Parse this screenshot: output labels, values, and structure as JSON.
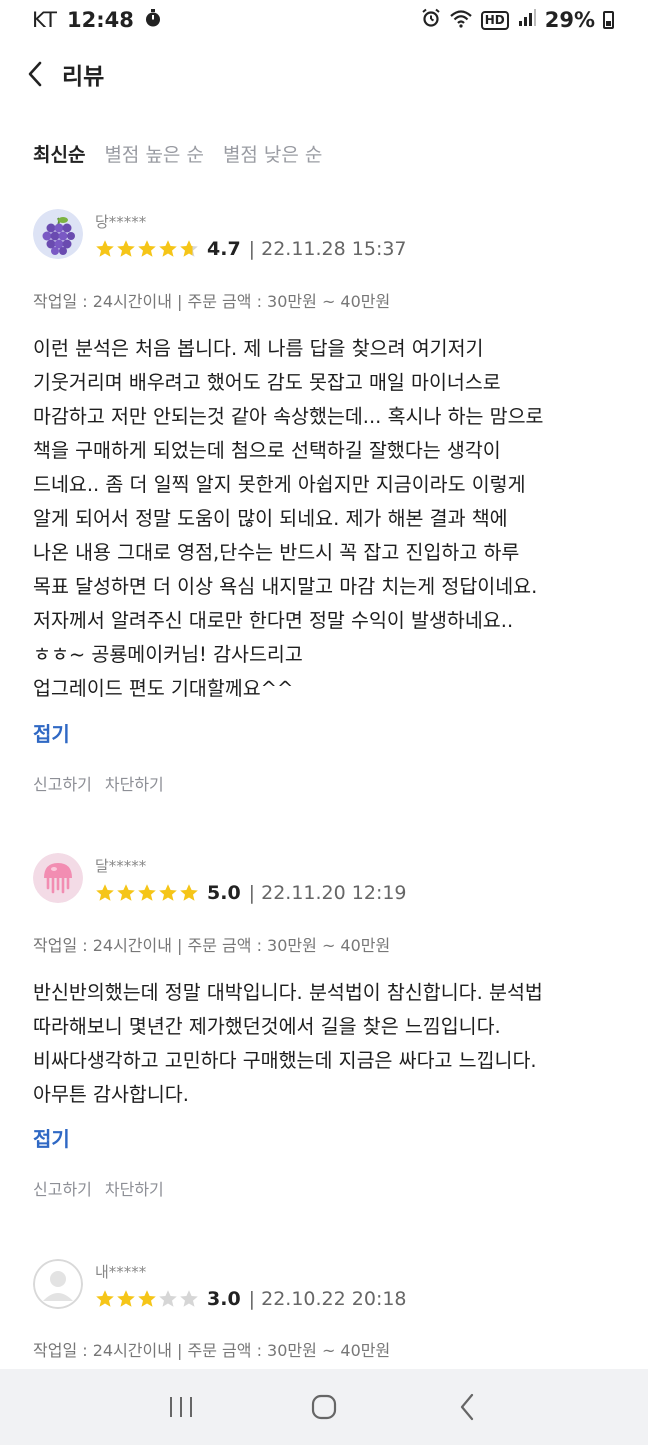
{
  "status_bar": {
    "carrier": "KT",
    "time": "12:48",
    "battery": "29%",
    "hd": "HD"
  },
  "header": {
    "title": "리뷰"
  },
  "sort_tabs": [
    "최신순",
    "별점 높은 순",
    "별점 낮은 순"
  ],
  "reviews": [
    {
      "name": "당*****",
      "avatar": "grape",
      "rating": 4.7,
      "rating_text": "4.7",
      "date": "| 22.11.28 15:37",
      "meta": "작업일 : 24시간이내 | 주문 금액 : 30만원 ~ 40만원",
      "body": "이런 분석은 처음 봅니다. 제 나름 답을 찾으려 여기저기\n기웃거리며 배우려고 했어도 감도 못잡고 매일 마이너스로\n마감하고 저만 안되는것 같아 속상했는데... 혹시나 하는 맘으로\n책을 구매하게 되었는데 첨으로 선택하길 잘했다는 생각이\n드네요.. 좀 더 일찍 알지 못한게 아쉽지만 지금이라도 이렇게\n알게 되어서 정말 도움이 많이 되네요.  제가  해본 결과 책에\n나온 내용 그대로 영점,단수는 반드시 꼭 잡고 진입하고 하루\n목표 달성하면 더 이상 욕심 내지말고 마감 치는게 정답이네요.\n저자께서 알려주신 대로만 한다면 정말 수익이 발생하네요..\nㅎㅎ~                                         공룡메이커님!  감사드리고\n업그레이드 편도 기대할께요^^",
      "collapse": "접기",
      "report": "신고하기",
      "block": "차단하기"
    },
    {
      "name": "달*****",
      "avatar": "jellyfish",
      "rating": 5.0,
      "rating_text": "5.0",
      "date": "| 22.11.20 12:19",
      "meta": "작업일 : 24시간이내 | 주문 금액 : 30만원 ~ 40만원",
      "body": "반신반의했는데 정말 대박입니다. 분석법이 참신합니다. 분석법\n따라해보니 몇년간 제가했던것에서 길을 찾은 느낌입니다.\n비싸다생각하고 고민하다 구매했는데 지금은 싸다고 느낍니다.\n아무튼 감사합니다.",
      "collapse": "접기",
      "report": "신고하기",
      "block": "차단하기"
    },
    {
      "name": "내*****",
      "avatar": "default",
      "rating": 3.0,
      "rating_text": "3.0",
      "date": "| 22.10.22 20:18",
      "meta": "작업일 : 24시간이내 | 주문 금액 : 30만원 ~ 40만원"
    }
  ],
  "colors": {
    "star": "#f5c518",
    "star_empty": "#d6d6d6",
    "link": "#2f68c4"
  }
}
